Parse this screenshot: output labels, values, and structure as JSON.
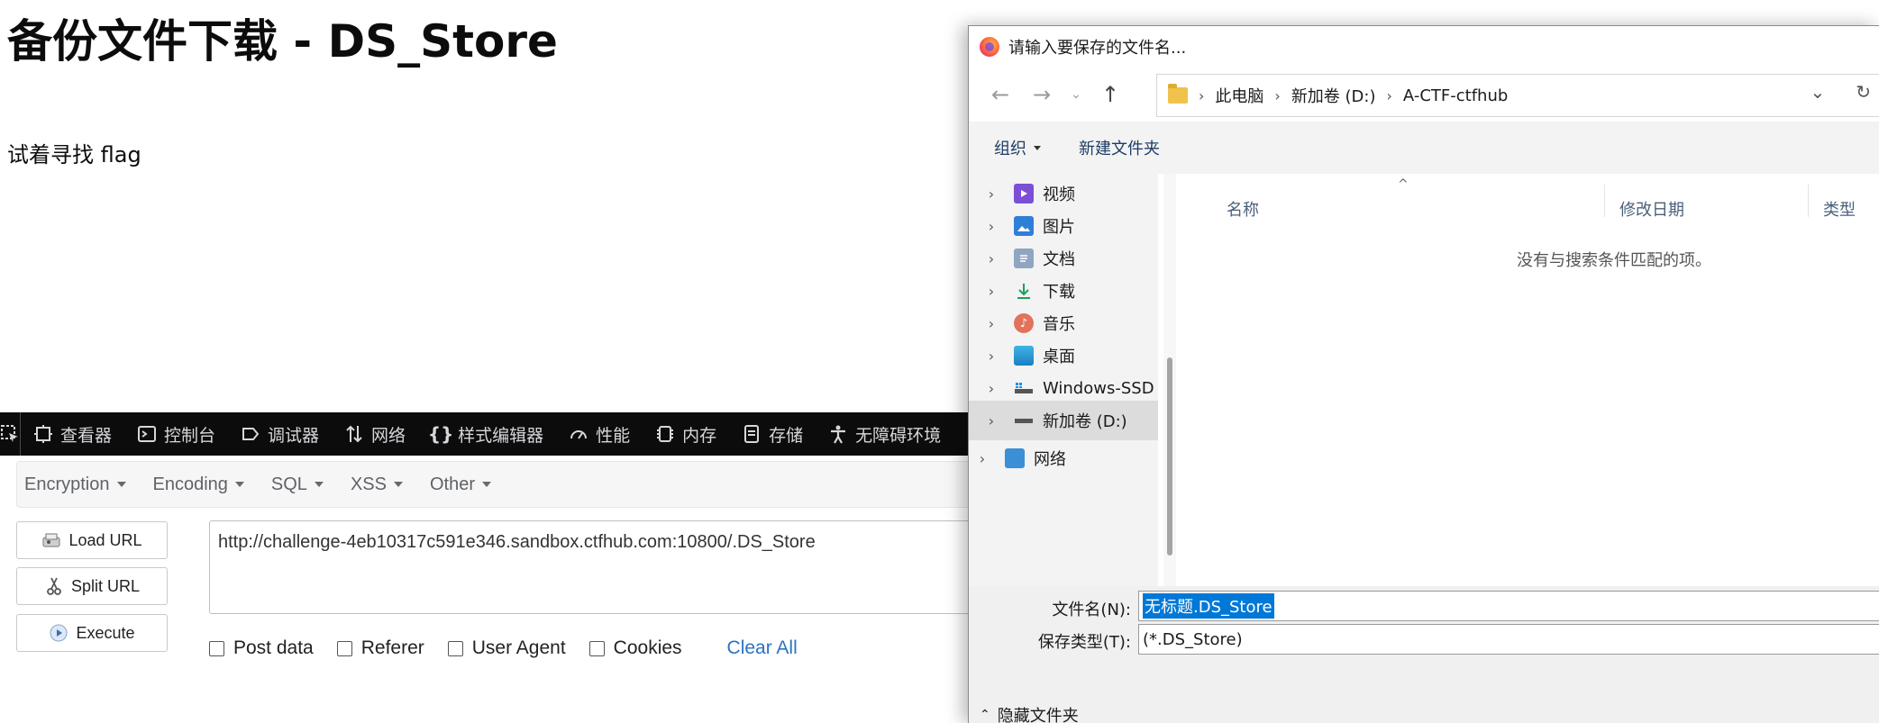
{
  "page": {
    "title": "备份文件下载 - DS_Store",
    "text": "试着寻找 flag"
  },
  "devtools": {
    "tabs": [
      {
        "label": "查看器",
        "icon": "inspector-icon"
      },
      {
        "label": "控制台",
        "icon": "console-icon"
      },
      {
        "label": "调试器",
        "icon": "debugger-icon"
      },
      {
        "label": "网络",
        "icon": "network-icon"
      },
      {
        "label": "样式编辑器",
        "icon": "style-editor-icon"
      },
      {
        "label": "性能",
        "icon": "performance-icon"
      },
      {
        "label": "内存",
        "icon": "memory-icon"
      },
      {
        "label": "存储",
        "icon": "storage-icon"
      },
      {
        "label": "无障碍环境",
        "icon": "accessibility-icon"
      }
    ]
  },
  "hackbar": {
    "menus": [
      "Encryption",
      "Encoding",
      "SQL",
      "XSS",
      "Other"
    ],
    "load_url": "Load URL",
    "split_url": "Split URL",
    "execute": "Execute",
    "url": "http://challenge-4eb10317c591e346.sandbox.ctfhub.com:10800/.DS_Store",
    "options": [
      "Post data",
      "Referer",
      "User Agent",
      "Cookies"
    ],
    "clear_all": "Clear All"
  },
  "dialog": {
    "title": "请输入要保存的文件名...",
    "breadcrumb": [
      "此电脑",
      "新加卷 (D:)",
      "A-CTF-ctfhub"
    ],
    "organize": "组织",
    "new_folder": "新建文件夹",
    "sidebar": [
      {
        "label": "视频",
        "icon": "videos-icon"
      },
      {
        "label": "图片",
        "icon": "pictures-icon"
      },
      {
        "label": "文档",
        "icon": "documents-icon"
      },
      {
        "label": "下载",
        "icon": "downloads-icon"
      },
      {
        "label": "音乐",
        "icon": "music-icon"
      },
      {
        "label": "桌面",
        "icon": "desktop-icon"
      },
      {
        "label": "Windows-SSD",
        "icon": "drive-icon"
      },
      {
        "label": "新加卷 (D:)",
        "icon": "drive-icon"
      },
      {
        "label": "网络",
        "icon": "network-icon"
      }
    ],
    "columns": [
      "名称",
      "修改日期",
      "类型"
    ],
    "empty_message": "没有与搜索条件匹配的项。",
    "filename_label": "文件名(N):",
    "filename_value": "无标题.DS_Store",
    "filetype_label": "保存类型(T):",
    "filetype_value": "(*.DS_Store)",
    "hide_folders": "隐藏文件夹"
  }
}
